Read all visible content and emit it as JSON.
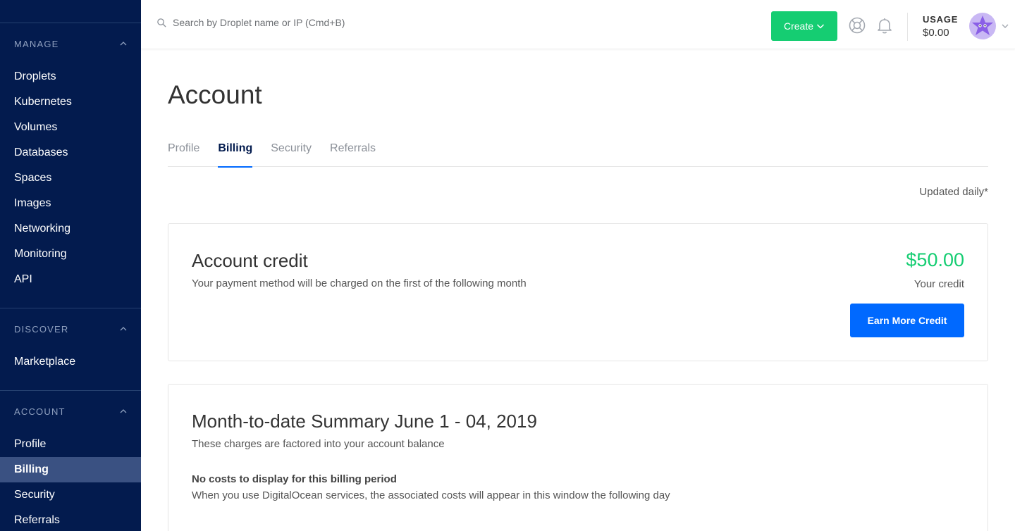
{
  "sidebar": {
    "sections": [
      {
        "title": "MANAGE",
        "items": [
          "Droplets",
          "Kubernetes",
          "Volumes",
          "Databases",
          "Spaces",
          "Images",
          "Networking",
          "Monitoring",
          "API"
        ]
      },
      {
        "title": "DISCOVER",
        "items": [
          "Marketplace"
        ]
      },
      {
        "title": "ACCOUNT",
        "items": [
          "Profile",
          "Billing",
          "Security",
          "Referrals"
        ],
        "active": "Billing"
      }
    ]
  },
  "topbar": {
    "search_placeholder": "Search by Droplet name or IP (Cmd+B)",
    "create_label": "Create",
    "usage_label": "USAGE",
    "usage_value": "$0.00",
    "icons": [
      "search-icon",
      "chevron-down-icon",
      "help-lifebuoy-icon",
      "notification-bell-icon",
      "avatar",
      "chevron-down-icon"
    ]
  },
  "page": {
    "title": "Account",
    "tabs": [
      "Profile",
      "Billing",
      "Security",
      "Referrals"
    ],
    "active_tab": "Billing",
    "updated_note": "Updated daily*"
  },
  "credit_card": {
    "title": "Account credit",
    "subtitle": "Your payment method will be charged on the first of the following month",
    "amount": "$50.00",
    "amount_label": "Your credit",
    "button_label": "Earn More Credit"
  },
  "summary_card": {
    "title": "Month-to-date Summary June 1 - 04, 2019",
    "subtitle": "These charges are factored into your account balance",
    "empty_title": "No costs to display for this billing period",
    "empty_text": "When you use DigitalOcean services, the associated costs will appear in this window the following day"
  },
  "colors": {
    "sidebar_bg": "#031b4e",
    "sidebar_active_bg": "#3a5182",
    "create_green": "#15cd72",
    "primary_blue": "#0069ff",
    "credit_green": "#15cd72"
  }
}
